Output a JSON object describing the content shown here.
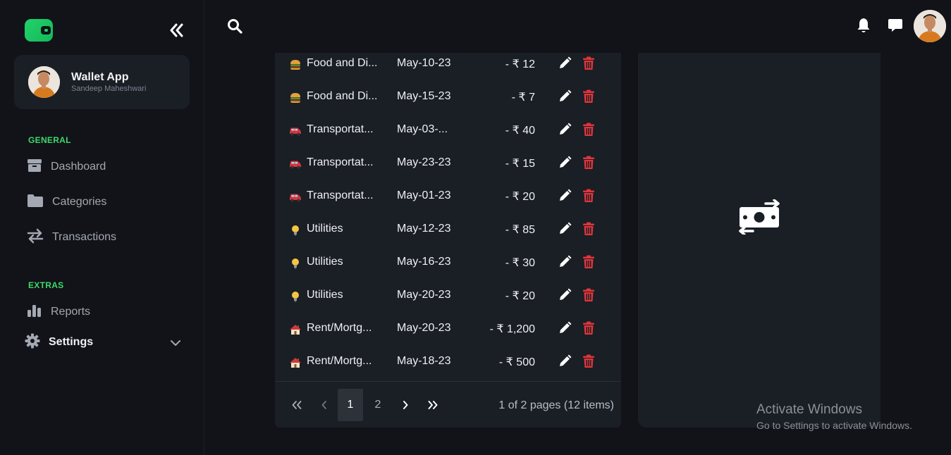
{
  "app": {
    "title": "Wallet App",
    "user_name": "Sandeep Maheshwari"
  },
  "sidebar": {
    "sections": [
      {
        "title": "GENERAL"
      },
      {
        "title": "EXTRAS"
      }
    ],
    "items": [
      {
        "label": "Dashboard",
        "icon": "dashboard-icon"
      },
      {
        "label": "Categories",
        "icon": "folder-icon"
      },
      {
        "label": "Transactions",
        "icon": "transfer-arrows-icon"
      },
      {
        "label": "Reports",
        "icon": "bar-chart-icon"
      },
      {
        "label": "Settings",
        "icon": "gear-icon"
      }
    ]
  },
  "colors": {
    "accent": "#3fd86a",
    "danger": "#e0353b",
    "background": "#111318",
    "card": "#1a1e25"
  },
  "transactions": [
    {
      "icon": "burger-icon",
      "category": "Food and Di...",
      "date": "May-10-23",
      "amount": "- ₹ 12"
    },
    {
      "icon": "burger-icon",
      "category": "Food and Di...",
      "date": "May-15-23",
      "amount": "- ₹ 7"
    },
    {
      "icon": "car-icon",
      "category": "Transportat...",
      "date": "May-03-...",
      "amount": "- ₹ 40"
    },
    {
      "icon": "car-icon",
      "category": "Transportat...",
      "date": "May-23-23",
      "amount": "- ₹ 15"
    },
    {
      "icon": "car-icon",
      "category": "Transportat...",
      "date": "May-01-23",
      "amount": "- ₹ 20"
    },
    {
      "icon": "lightbulb-icon",
      "category": "Utilities",
      "date": "May-12-23",
      "amount": "- ₹ 85"
    },
    {
      "icon": "lightbulb-icon",
      "category": "Utilities",
      "date": "May-16-23",
      "amount": "- ₹ 30"
    },
    {
      "icon": "lightbulb-icon",
      "category": "Utilities",
      "date": "May-20-23",
      "amount": "- ₹ 20"
    },
    {
      "icon": "house-icon",
      "category": "Rent/Mortg...",
      "date": "May-20-23",
      "amount": "- ₹ 1,200"
    },
    {
      "icon": "house-icon",
      "category": "Rent/Mortg...",
      "date": "May-18-23",
      "amount": "- ₹ 500"
    }
  ],
  "pagination": {
    "pages": [
      "1",
      "2"
    ],
    "current": "1",
    "info": "1 of 2 pages (12 items)"
  },
  "watermark": {
    "title": "Activate Windows",
    "subtitle": "Go to Settings to activate Windows."
  }
}
